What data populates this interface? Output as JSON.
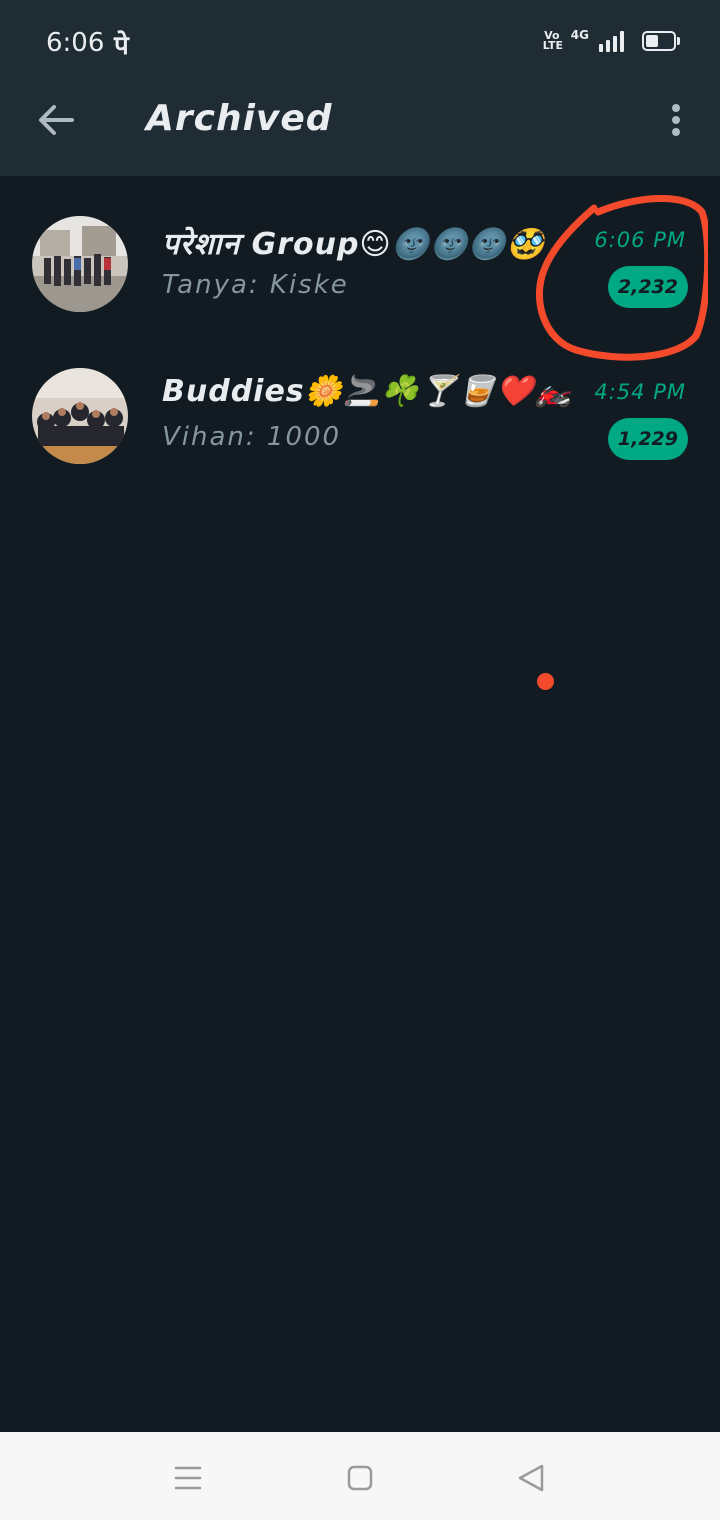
{
  "status_bar": {
    "time": "6:06",
    "app_glyph": "पे",
    "volte": "Vo LTE",
    "network": "4G"
  },
  "app_bar": {
    "title": "Archived",
    "back_icon": "arrow-left-icon",
    "menu_icon": "more-vertical-icon"
  },
  "chats": [
    {
      "name": "परेशान Group😊🌚🌚🌚🥸",
      "preview": "Tanya: Kiske",
      "time": "6:06 PM",
      "unread": "2,232"
    },
    {
      "name": "Buddies🌼🚬☘️🍸🥃❤️🏍️",
      "preview": "Vihan: 1000",
      "time": "4:54 PM",
      "unread": "1,229"
    }
  ],
  "colors": {
    "background": "#121b22",
    "topbar": "#1f2c34",
    "accent": "#00a884",
    "annotation": "#f44a2c",
    "navbar": "#f7f7f7"
  },
  "nav_bar": {
    "menu_icon": "hamburger-icon",
    "home_icon": "square-home-icon",
    "back_icon": "triangle-back-icon"
  }
}
